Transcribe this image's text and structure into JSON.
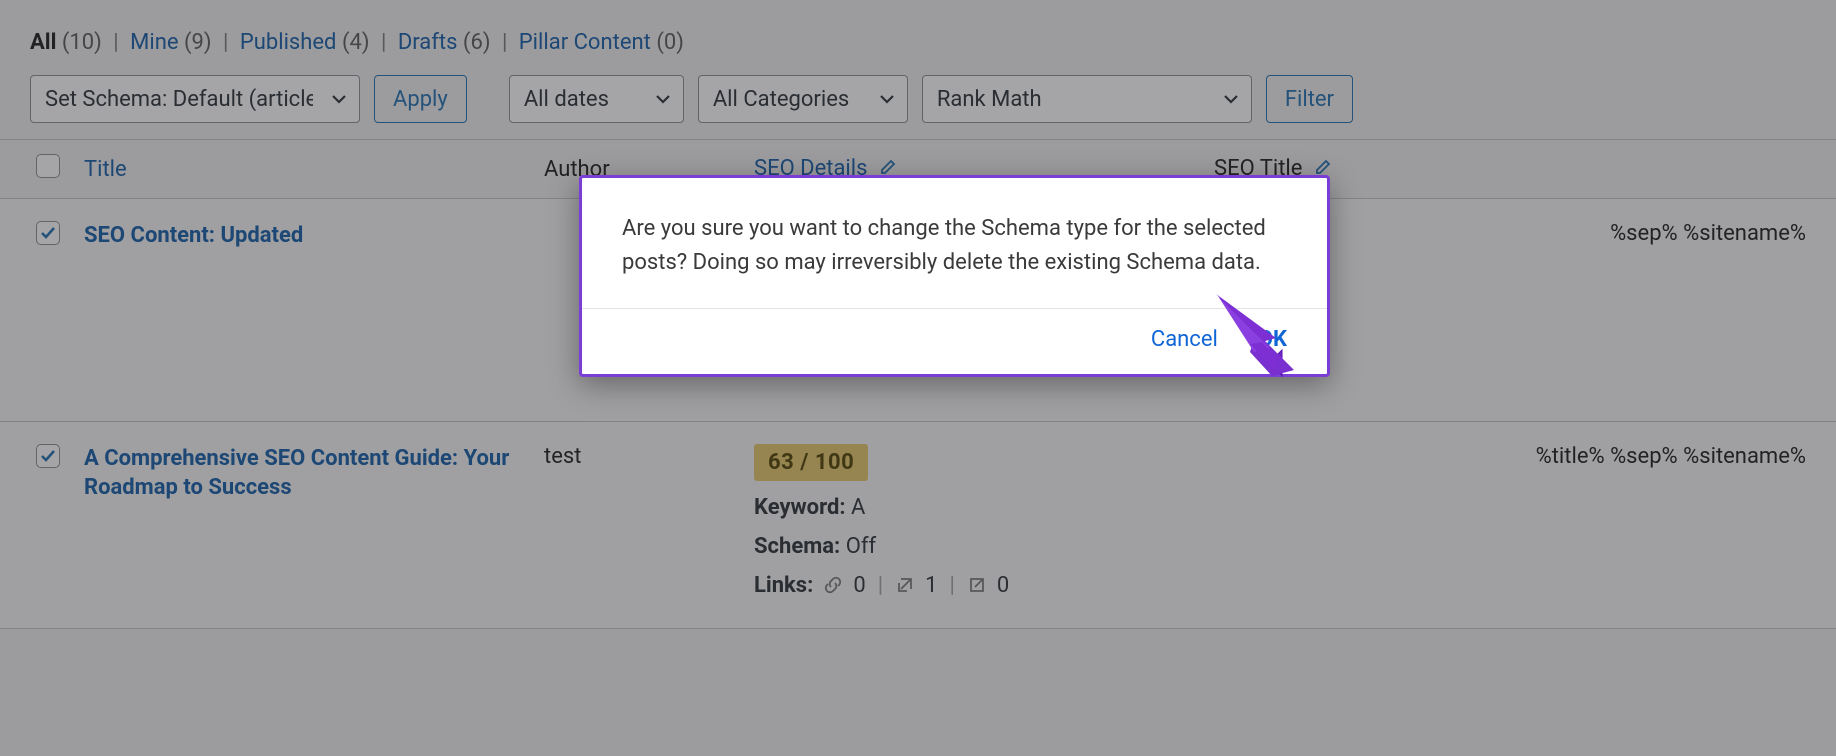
{
  "filters": {
    "all": {
      "label": "All",
      "count": "(10)"
    },
    "mine": {
      "label": "Mine",
      "count": "(9)"
    },
    "pub": {
      "label": "Published",
      "count": "(4)"
    },
    "drafts": {
      "label": "Drafts",
      "count": "(6)"
    },
    "pillar": {
      "label": "Pillar Content",
      "count": "(0)"
    }
  },
  "toolbar": {
    "bulk_action": "Set Schema: Default (article)",
    "apply": "Apply",
    "dates": "All dates",
    "cats": "All Categories",
    "rankmath": "Rank Math",
    "filter": "Filter"
  },
  "columns": {
    "title": "Title",
    "author": "Author",
    "seo": "SEO Details",
    "seo_title": "SEO Title"
  },
  "rows": [
    {
      "title": "SEO Content: Updated",
      "author": "",
      "seo_title": "%sep% %sitename%"
    },
    {
      "title": "A Comprehensive SEO Content Guide: Your Roadmap to Success",
      "author": "test",
      "score": "63 / 100",
      "keyword_label": "Keyword:",
      "keyword_value": "A",
      "schema_label": "Schema:",
      "schema_value": "Off",
      "links_label": "Links:",
      "links_internal": "0",
      "links_external": "1",
      "links_incoming": "0",
      "seo_title": "%title% %sep% %sitename%"
    }
  ],
  "dialog": {
    "message": "Are you sure you want to change the Schema type for the selected posts? Doing so may irreversibly delete the existing Schema data.",
    "cancel": "Cancel",
    "ok": "OK"
  }
}
